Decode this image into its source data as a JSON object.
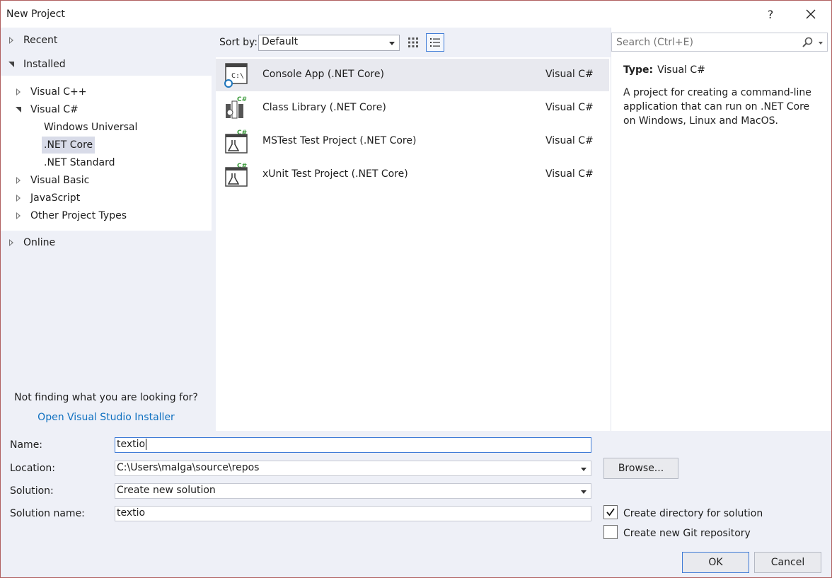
{
  "window": {
    "title": "New Project",
    "help": "?",
    "close": "✕"
  },
  "tree": {
    "recent": "Recent",
    "installed": "Installed",
    "installed_items": [
      "Visual C++",
      "Visual C#",
      "Windows Universal",
      ".NET Core",
      ".NET Standard",
      "Visual Basic",
      "JavaScript",
      "Other Project Types"
    ],
    "selected_item": ".NET Core",
    "online": "Online"
  },
  "help_panel": {
    "not_finding": "Not finding what you are looking for?",
    "installer_link": "Open Visual Studio Installer"
  },
  "toolbar": {
    "sort_label": "Sort by:",
    "sort_value": "Default"
  },
  "search": {
    "placeholder": "Search (Ctrl+E)"
  },
  "templates": [
    {
      "name": "Console App (.NET Core)",
      "lang": "Visual C#",
      "selected": true
    },
    {
      "name": "Class Library (.NET Core)",
      "lang": "Visual C#"
    },
    {
      "name": "MSTest Test Project (.NET Core)",
      "lang": "Visual C#"
    },
    {
      "name": "xUnit Test Project (.NET Core)",
      "lang": "Visual C#"
    }
  ],
  "description": {
    "type_label": "Type:",
    "type_value": "Visual C#",
    "text": "A project for creating a command-line application that can run on .NET Core on Windows, Linux and MacOS."
  },
  "form": {
    "name_label": "Name:",
    "name_value": "textio",
    "location_label": "Location:",
    "location_value": "C:\\Users\\malga\\source\\repos",
    "solution_label": "Solution:",
    "solution_value": "Create new solution",
    "solution_name_label": "Solution name:",
    "solution_name_value": "textio",
    "browse": "Browse...",
    "create_dir_label": "Create directory for solution",
    "create_dir_checked": true,
    "git_label": "Create new Git repository",
    "git_checked": false,
    "ok": "OK",
    "cancel": "Cancel"
  },
  "colors": {
    "accent": "#3d7ad6",
    "link": "#0e70c0",
    "panel": "#eef0f7",
    "csharp_green": "#3a9a3a"
  }
}
